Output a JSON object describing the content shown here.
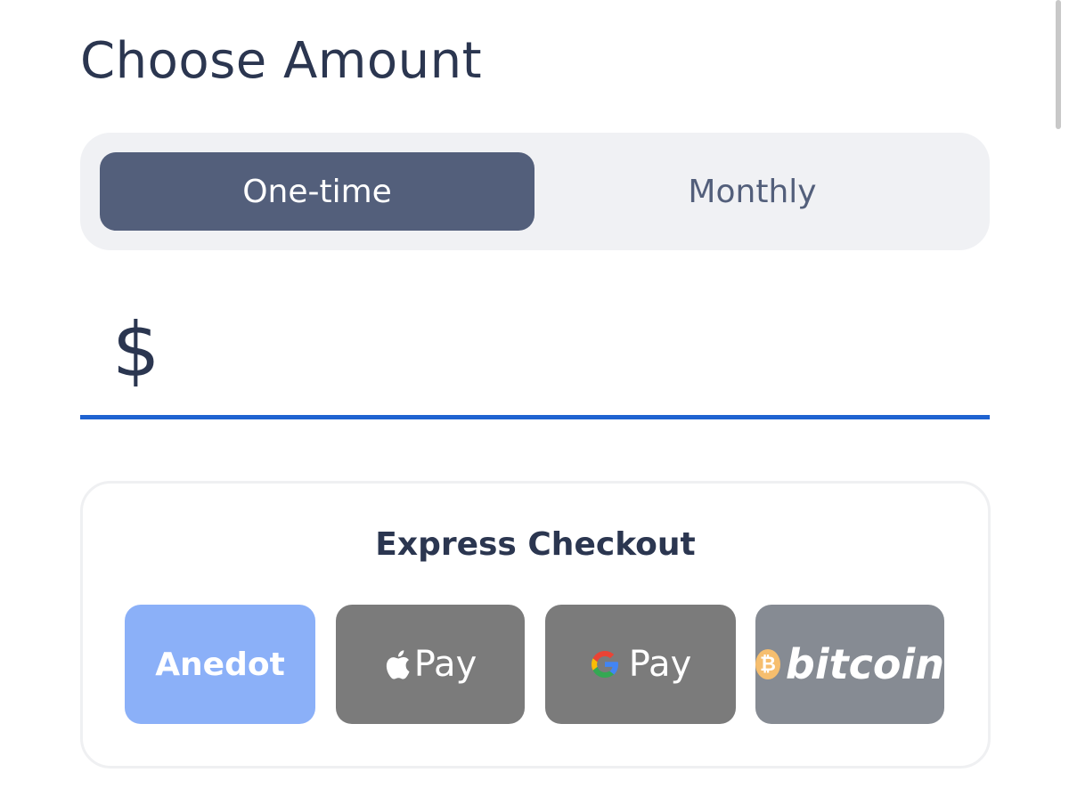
{
  "header": {
    "title": "Choose Amount"
  },
  "frequency": {
    "options": [
      {
        "label": "One-time",
        "selected": true
      },
      {
        "label": "Monthly",
        "selected": false
      }
    ]
  },
  "amount": {
    "currency_symbol": "$",
    "value": "",
    "placeholder": ""
  },
  "express_checkout": {
    "title": "Express Checkout",
    "buttons": [
      {
        "label": "Anedot",
        "icon": "",
        "color": "#8bb0f8"
      },
      {
        "label": "Pay",
        "icon": "apple-icon",
        "color": "#7b7b7b"
      },
      {
        "label": "Pay",
        "icon": "google-g-icon",
        "color": "#7b7b7b"
      },
      {
        "label": "bitcoin",
        "icon": "bitcoin-coin-icon",
        "color": "#868b93"
      }
    ]
  },
  "colors": {
    "accent": "#1f63d1",
    "selected_toggle": "#535f7b",
    "text": "#2b3650"
  }
}
